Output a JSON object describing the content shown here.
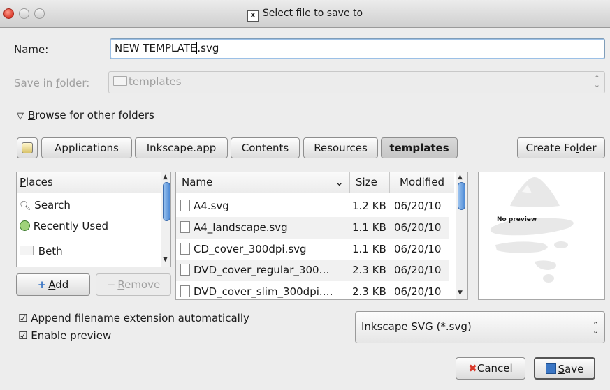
{
  "window": {
    "title": "Select file to save to"
  },
  "name_field": {
    "label_u": "N",
    "label_rest": "ame:",
    "value_before_caret": "NEW TEMPLATE",
    "value_after_caret": ".svg"
  },
  "save_in": {
    "label_pre": "Save in ",
    "label_u": "f",
    "label_rest": "older:",
    "value": "templates"
  },
  "browse_toggle": {
    "glyph": "▽",
    "label_u": "B",
    "label_rest": "rowse for other folders"
  },
  "path_bar": {
    "buttons": [
      "Applications",
      "Inkscape.app",
      "Contents",
      "Resources",
      "templates"
    ],
    "active": "templates"
  },
  "create_folder": {
    "pre": "Create Fo",
    "u": "l",
    "post": "der"
  },
  "places": {
    "header_u": "P",
    "header_rest": "laces",
    "items": [
      {
        "label": "Search",
        "icon": "search-icon"
      },
      {
        "label": "Recently Used",
        "icon": "recent-icon"
      },
      {
        "label": "Beth",
        "icon": "folder-icon"
      }
    ]
  },
  "add_button": {
    "glyph": "+",
    "u": "A",
    "rest": "dd"
  },
  "remove_button": {
    "glyph": "−",
    "u": "R",
    "rest": "emove"
  },
  "files": {
    "columns": [
      "Name",
      "Size",
      "Modified"
    ],
    "sort_glyph": "⌄",
    "rows": [
      {
        "name": "A4.svg",
        "size": "1.2 KB",
        "modified": "06/20/10"
      },
      {
        "name": "A4_landscape.svg",
        "size": "1.1 KB",
        "modified": "06/20/10"
      },
      {
        "name": "CD_cover_300dpi.svg",
        "size": "1.1 KB",
        "modified": "06/20/10"
      },
      {
        "name": "DVD_cover_regular_300…",
        "size": "2.3 KB",
        "modified": "06/20/10"
      },
      {
        "name": "DVD_cover_slim_300dpi.…",
        "size": "2.3 KB",
        "modified": "06/20/10"
      }
    ]
  },
  "preview": {
    "text": "No preview"
  },
  "options": {
    "append_extension": {
      "label": "Append filename extension automatically",
      "checked": true
    },
    "enable_preview": {
      "label": "Enable preview",
      "checked": true
    }
  },
  "checkbox_glyph": "☑",
  "filetype": {
    "value": "Inkscape SVG (*.svg)"
  },
  "cancel_button": {
    "u": "C",
    "rest": "ancel"
  },
  "save_button": {
    "u": "S",
    "rest": "ave"
  },
  "colors": {
    "accent": "#4e8bd6",
    "close_red": "#d9392a",
    "focus_border": "#7f9db9"
  }
}
